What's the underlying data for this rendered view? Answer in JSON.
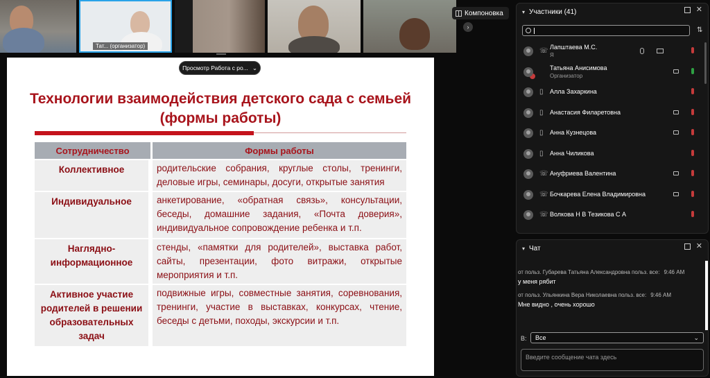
{
  "video_strip": {
    "tiles": [
      {
        "label": ""
      },
      {
        "label": "Тат... (организатор)"
      },
      {
        "label": ""
      },
      {
        "label": ""
      },
      {
        "label": ""
      }
    ],
    "layout_button": "Компоновка",
    "next_icon": "chevron-right-icon"
  },
  "slide": {
    "view_pill": "Просмотр Работа с ро...",
    "title_line1": "Технологии взаимодействия детского сада с семьей",
    "title_line2": "(формы работы)",
    "table": {
      "headers": [
        "Сотрудничество",
        "Формы работы"
      ],
      "rows": [
        {
          "type": "Коллективное",
          "forms": "родительские собрания, круглые столы, тренинги, деловые игры, семинары, досуги, открытые занятия"
        },
        {
          "type": "Индивидуальное",
          "forms": "анкетирование, «обратная связь», консультации, беседы, домашние задания, «Почта доверия», индивидуальное сопровождение ребенка и т.п."
        },
        {
          "type": "Наглядно-информационное",
          "forms": "стенды, «памятки для родителей», выставка работ, сайты, презентации, фото витражи, открытые мероприятия и т.п."
        },
        {
          "type": "Активное участие родителей в решении образовательных задач",
          "forms": "подвижные игры, совместные занятия, соревнования, тренинги, участие в выставках, конкурсах, чтение, беседы с детьми, походы, экскурсии и т.п."
        }
      ]
    },
    "colors": {
      "title": "#a8141c",
      "rule": "#c4131c",
      "header_bg": "#a7acb3",
      "cell_bg": "#eeeeee"
    }
  },
  "participants": {
    "title": "Участники (41)",
    "search_placeholder": "",
    "list": [
      {
        "name": "Лапштаева М.С.",
        "role": "Я",
        "device": "phone-icon",
        "mic": "off",
        "cam": false,
        "extra": true
      },
      {
        "name": "Татьяна Анисимова",
        "role": "Организатор",
        "device": "",
        "mic": "on",
        "cam": true,
        "extra": false
      },
      {
        "name": "Алла Захаркина",
        "role": "",
        "device": "mobile-icon",
        "mic": "off",
        "cam": false,
        "extra": false
      },
      {
        "name": "Анастасия Филаретовна",
        "role": "",
        "device": "mobile-icon",
        "mic": "off",
        "cam": true,
        "extra": false
      },
      {
        "name": "Анна Кузнецова",
        "role": "",
        "device": "mobile-icon",
        "mic": "off",
        "cam": true,
        "extra": false
      },
      {
        "name": "Анна Чиликова",
        "role": "",
        "device": "mobile-icon",
        "mic": "off",
        "cam": false,
        "extra": false
      },
      {
        "name": "Ануфриева Валентина",
        "role": "",
        "device": "phone-icon",
        "mic": "off",
        "cam": true,
        "extra": false
      },
      {
        "name": "Бочкарева Елена Владимировна",
        "role": "",
        "device": "phone-icon",
        "mic": "off",
        "cam": true,
        "extra": false
      },
      {
        "name": "Волкова Н В Тезикова С А",
        "role": "",
        "device": "phone-icon",
        "mic": "off",
        "cam": false,
        "extra": false
      }
    ]
  },
  "chat": {
    "title": "Чат",
    "messages": [
      {
        "from": "от польз. Губарева Татьяна Александровна польз. все:",
        "time": "9:46 AM",
        "text": "у меня рябит"
      },
      {
        "from": "от польз. Ульянкина Вера Николаевна польз. все:",
        "time": "9:46 AM",
        "text": "Мне видно , очень хорошо"
      }
    ],
    "to_label": "В:",
    "to_value": "Все",
    "input_placeholder": "Введите сообщение чата здесь"
  }
}
